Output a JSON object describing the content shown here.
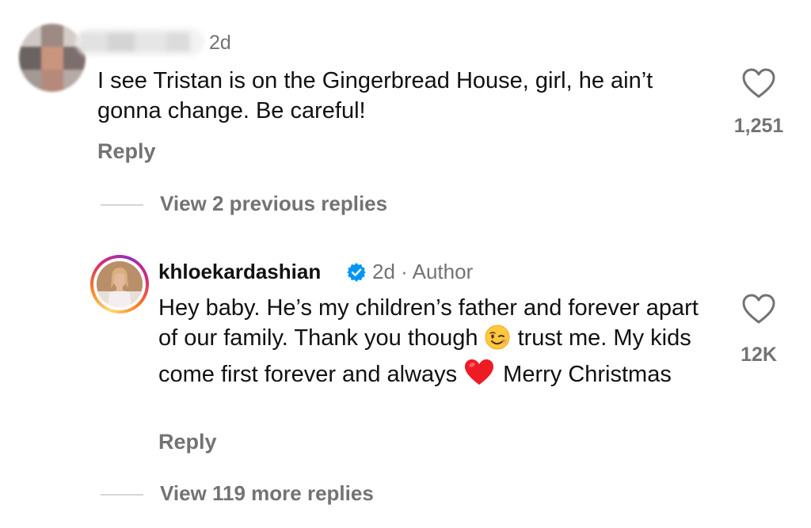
{
  "comments": [
    {
      "time": "2d",
      "text": "I see Tristan is on the Gingerbread House, girl, he ain’t gonna change. Be careful!",
      "likes": "1,251",
      "reply_label": "Reply",
      "like_icon": "heart-outline-icon"
    }
  ],
  "view_previous": "View 2 previous replies",
  "author_reply": {
    "username": "khloekardashian",
    "verified_icon": "verified-badge-icon",
    "time": "2d",
    "separator": "·",
    "author_label": "Author",
    "text_1": "Hey baby. He’s my children’s father and forever apart of our family. Thank you though",
    "emoji_1": "winking-face-emoji",
    "text_2": "trust me. My kids come first forever and always",
    "emoji_2": "red-heart-emoji",
    "text_3": "Merry Christmas",
    "likes": "12K",
    "reply_label": "Reply",
    "like_icon": "heart-outline-icon"
  },
  "view_more": "View 119 more replies",
  "colors": {
    "text": "#111111",
    "secondary": "#737373",
    "verified": "#0095f6",
    "heart": "#ed1c24",
    "emoji_yellow": "#ffc83d"
  }
}
